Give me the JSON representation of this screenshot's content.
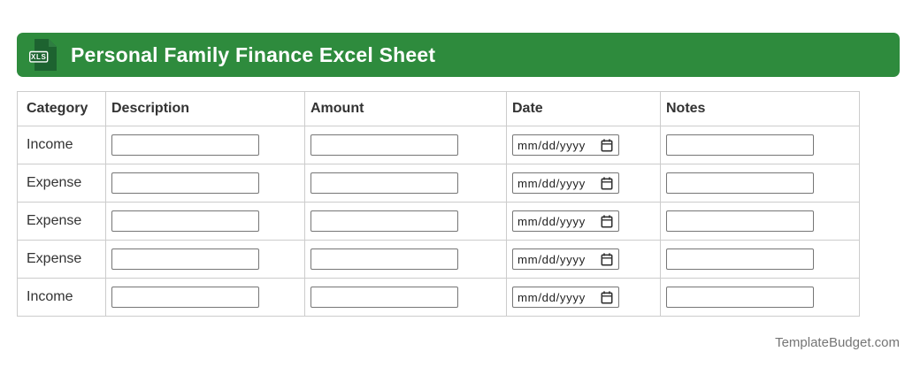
{
  "colors": {
    "header_bg": "#2e8b3d",
    "icon_document_green": "#1d6330",
    "icon_fold_green": "#2f7d42",
    "table_border": "#cccccc",
    "input_border": "#767676",
    "body_text": "#333333",
    "footer_text": "#757575"
  },
  "header": {
    "title": "Personal Family Finance Excel Sheet",
    "file_icon_label": "XLS"
  },
  "table": {
    "columns": [
      "Category",
      "Description",
      "Amount",
      "Date",
      "Notes"
    ],
    "rows": [
      {
        "category": "Income",
        "description_value": "",
        "amount_value": "",
        "date_placeholder": "mm/dd/yyyy",
        "notes_value": ""
      },
      {
        "category": "Expense",
        "description_value": "",
        "amount_value": "",
        "date_placeholder": "mm/dd/yyyy",
        "notes_value": ""
      },
      {
        "category": "Expense",
        "description_value": "",
        "amount_value": "",
        "date_placeholder": "mm/dd/yyyy",
        "notes_value": ""
      },
      {
        "category": "Expense",
        "description_value": "",
        "amount_value": "",
        "date_placeholder": "mm/dd/yyyy",
        "notes_value": ""
      },
      {
        "category": "Income",
        "description_value": "",
        "amount_value": "",
        "date_placeholder": "mm/dd/yyyy",
        "notes_value": ""
      }
    ]
  },
  "footer": {
    "text": "TemplateBudget.com"
  }
}
